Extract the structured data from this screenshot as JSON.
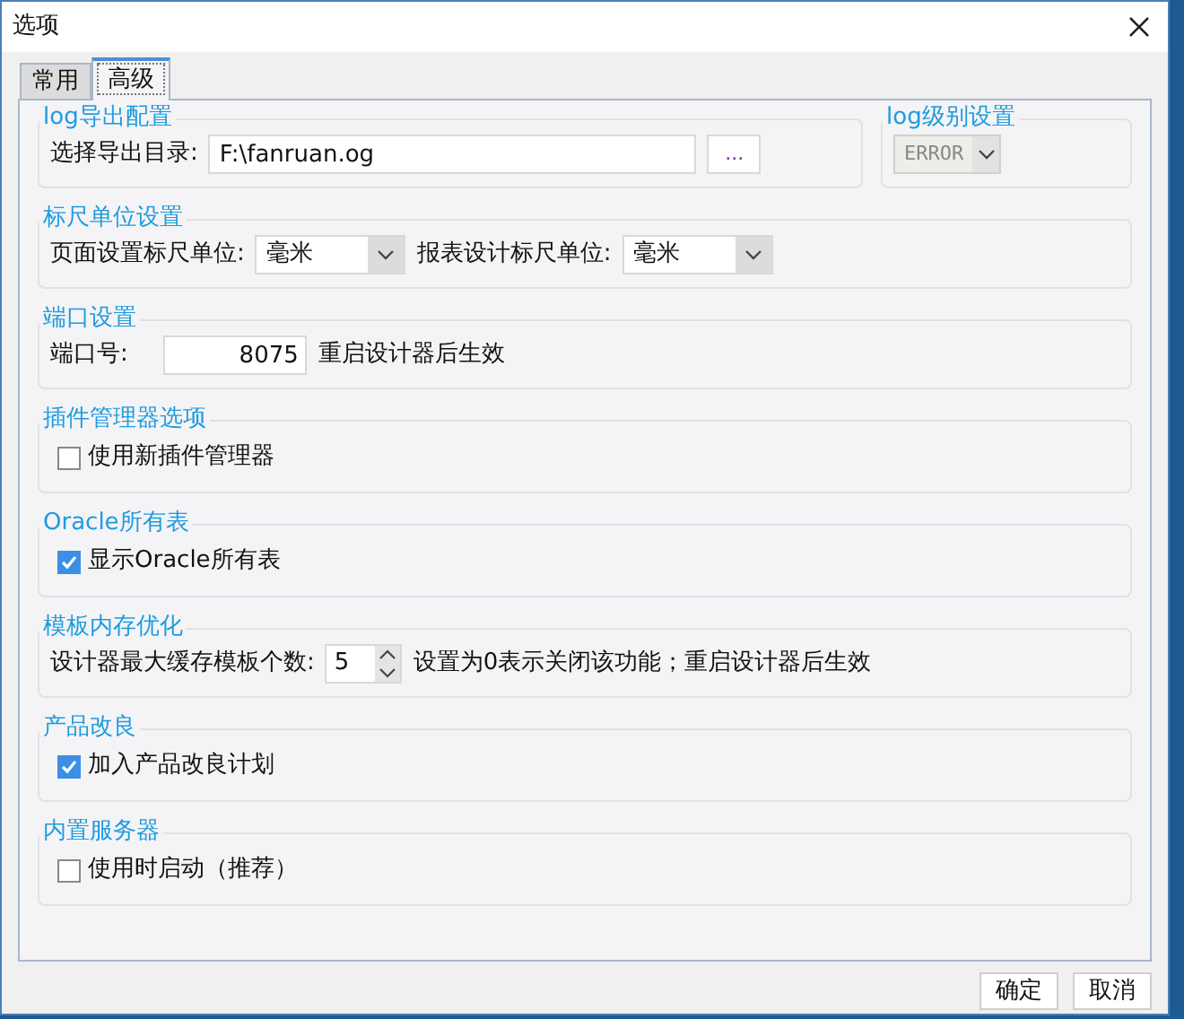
{
  "window": {
    "title": "选项"
  },
  "tabs": [
    {
      "label": "常用",
      "selected": false
    },
    {
      "label": "高级",
      "selected": true
    }
  ],
  "log_export": {
    "title": "log导出配置",
    "label": "选择导出目录:",
    "value": "F:\\fanruan.og",
    "browse": "..."
  },
  "log_level": {
    "title": "log级别设置",
    "value": "ERROR",
    "disabled": true
  },
  "groups": [
    {
      "kind": "units",
      "title": "标尺单位设置",
      "fields": [
        {
          "label": "页面设置标尺单位:",
          "value": "毫米"
        },
        {
          "label": "报表设计标尺单位:",
          "value": "毫米"
        }
      ]
    },
    {
      "kind": "port",
      "title": "端口设置",
      "label": "端口号:",
      "value": "8075",
      "note": "重启设计器后生效"
    },
    {
      "kind": "checkbox",
      "title": "插件管理器选项",
      "label": "使用新插件管理器",
      "checked": false
    },
    {
      "kind": "checkbox",
      "title": "Oracle所有表",
      "label": "显示Oracle所有表",
      "checked": true
    },
    {
      "kind": "spinner",
      "title": "模板内存优化",
      "label": "设计器最大缓存模板个数:",
      "value": "5",
      "note": "设置为0表示关闭该功能；重启设计器后生效"
    },
    {
      "kind": "checkbox",
      "title": "产品改良",
      "label": "加入产品改良计划",
      "checked": true
    },
    {
      "kind": "checkbox",
      "title": "内置服务器",
      "label": "使用时启动（推荐）",
      "checked": false
    }
  ],
  "buttons": [
    "确定",
    "取消"
  ]
}
